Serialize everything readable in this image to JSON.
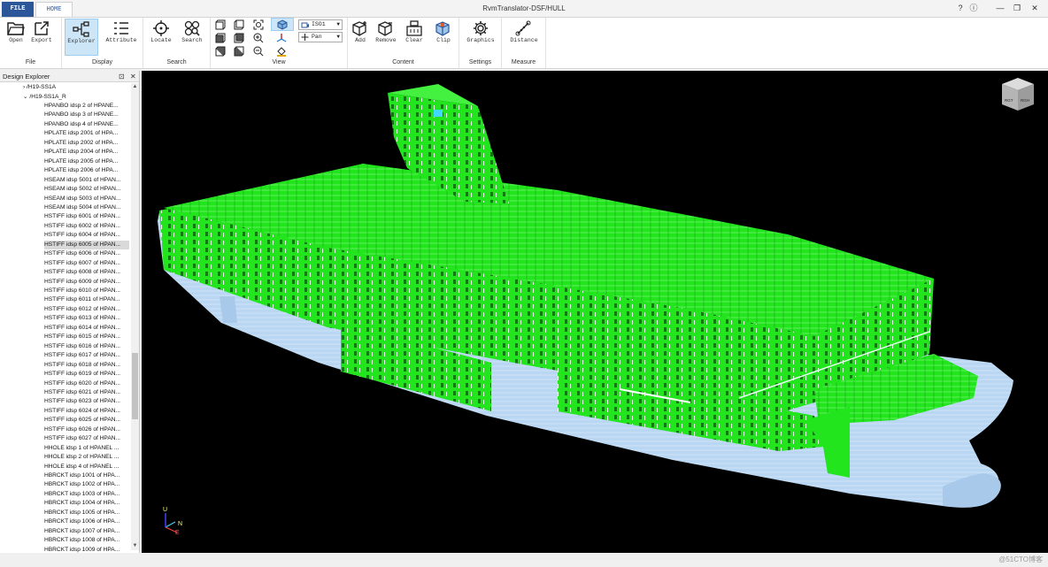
{
  "window": {
    "title": "RvmTranslator-DSF/HULL",
    "buttons": [
      "?",
      "ⓘ",
      "—",
      "❐",
      "✕"
    ]
  },
  "tabs": {
    "file": "FILE",
    "home": "HOME"
  },
  "ribbon": {
    "groups": {
      "file": "File",
      "display": "Display",
      "search": "Search",
      "view": "View",
      "content": "Content",
      "settings": "Settings",
      "measure": "Measure"
    },
    "buttons": {
      "open": "Open",
      "export": "Export",
      "explorer": "Explorer",
      "attribute": "Attribute",
      "locate": "Locate",
      "search": "Search",
      "add": "Add",
      "remove": "Remove",
      "clear": "Clear",
      "clip": "Clip",
      "graphics": "Graphics",
      "distance": "Distance"
    },
    "view_combo": "ISO1",
    "nav_combo": "Pan"
  },
  "explorer": {
    "title": "Design Explorer",
    "nodes": {
      "n1": "/H19-SS1A",
      "n2": "/H19-SS1A_R"
    },
    "items": [
      "HPANBO idsp 2 of HPANE...",
      "HPANBO idsp 3 of HPANE...",
      "HPANBO idsp 4 of HPANE...",
      "HPLATE idsp 2001 of HPA...",
      "HPLATE idsp 2002 of HPA...",
      "HPLATE idsp 2004 of HPA...",
      "HPLATE idsp 2005 of HPA...",
      "HPLATE idsp 2006 of HPA...",
      "HSEAM idsp 5001 of HPAN...",
      "HSEAM idsp 5002 of HPAN...",
      "HSEAM idsp 5003 of HPAN...",
      "HSEAM idsp 5004 of HPAN...",
      "HSTIFF idsp 6001 of HPAN...",
      "HSTIFF idsp 6002 of HPAN...",
      "HSTIFF idsp 6004 of HPAN...",
      "HSTIFF idsp 6005 of HPAN...",
      "HSTIFF idsp 6006 of HPAN...",
      "HSTIFF idsp 6007 of HPAN...",
      "HSTIFF idsp 6008 of HPAN...",
      "HSTIFF idsp 6009 of HPAN...",
      "HSTIFF idsp 6010 of HPAN...",
      "HSTIFF idsp 6011 of HPAN...",
      "HSTIFF idsp 6012 of HPAN...",
      "HSTIFF idsp 6013 of HPAN...",
      "HSTIFF idsp 6014 of HPAN...",
      "HSTIFF idsp 6015 of HPAN...",
      "HSTIFF idsp 6016 of HPAN...",
      "HSTIFF idsp 6017 of HPAN...",
      "HSTIFF idsp 6018 of HPAN...",
      "HSTIFF idsp 6019 of HPAN...",
      "HSTIFF idsp 6020 of HPAN...",
      "HSTIFF idsp 6021 of HPAN...",
      "HSTIFF idsp 6023 of HPAN...",
      "HSTIFF idsp 6024 of HPAN...",
      "HSTIFF idsp 6025 of HPAN...",
      "HSTIFF idsp 6026 of HPAN...",
      "HSTIFF idsp 6027 of HPAN...",
      "HHOLE idsp 1 of HPANEL ...",
      "HHOLE idsp 2 of HPANEL ...",
      "HHOLE idsp 4 of HPANEL ...",
      "HBRCKT idsp 1001 of HPA...",
      "HBRCKT idsp 1002 of HPA...",
      "HBRCKT idsp 1003 of HPA...",
      "HBRCKT idsp 1004 of HPA...",
      "HBRCKT idsp 1005 of HPA...",
      "HBRCKT idsp 1006 of HPA...",
      "HBRCKT idsp 1007 of HPA...",
      "HBRCKT idsp 1008 of HPA...",
      "HBRCKT idsp 1009 of HPA..."
    ],
    "selected_index": 15
  },
  "viewport": {
    "view_cube": {
      "left": "RGT",
      "right": "RGH"
    },
    "axes": {
      "up": "U",
      "north": "N",
      "east": "E"
    }
  },
  "watermark": "@51CTO博客",
  "colors": {
    "accent": "#2b579a",
    "structure_green": "#22e51e",
    "hull_blue": "#b9d6f2",
    "viewport_bg": "#000000"
  }
}
